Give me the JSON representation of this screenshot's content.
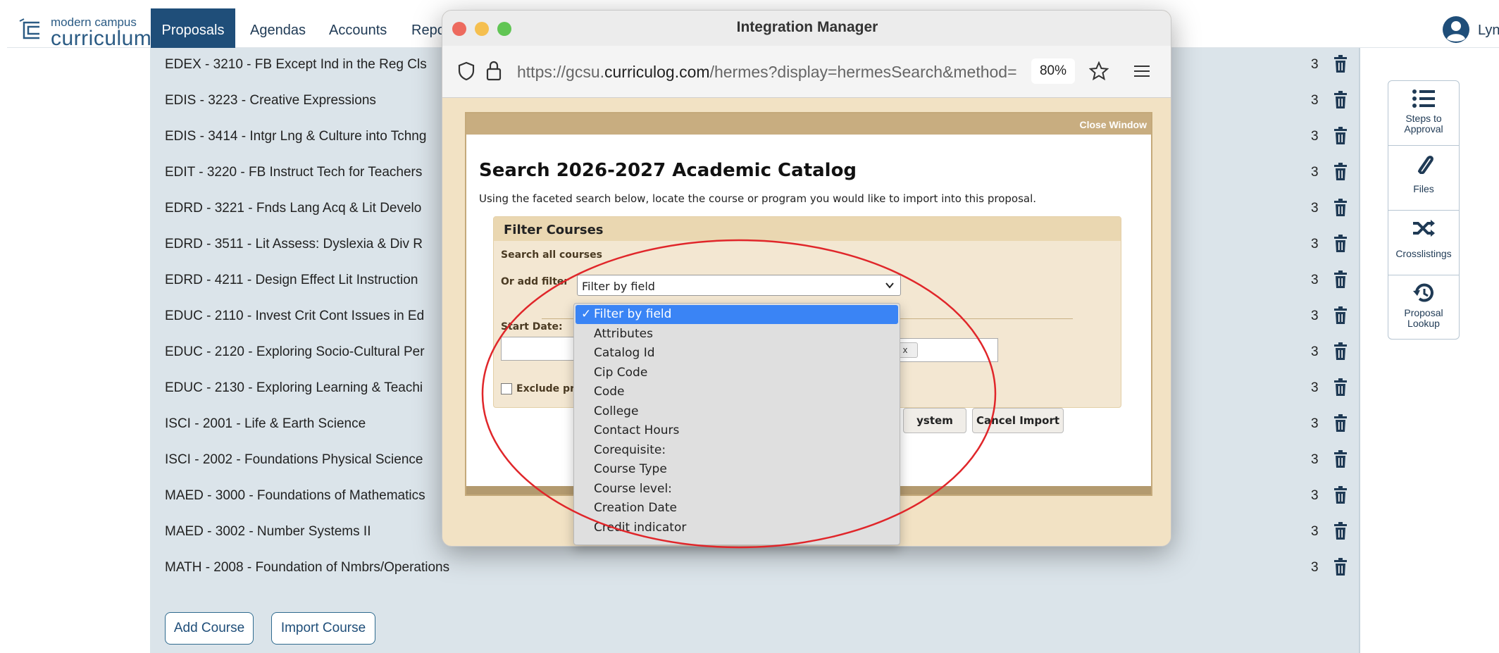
{
  "nav": {
    "logo_small": "modern campus",
    "logo_big": "curriculum",
    "logo_tm": "™",
    "active": "Proposals",
    "items": [
      "Agendas",
      "Accounts",
      "Repo"
    ],
    "user": "Lynd"
  },
  "courses": [
    {
      "name": "EDEX - 3210 - FB Except Ind in the Reg Cls",
      "credits": "3"
    },
    {
      "name": "EDIS - 3223 - Creative Expressions",
      "credits": "3"
    },
    {
      "name": "EDIS - 3414 - Intgr Lng & Culture into Tchng",
      "credits": "3"
    },
    {
      "name": "EDIT - 3220 - FB Instruct Tech for Teachers",
      "credits": "3"
    },
    {
      "name": "EDRD - 3221 - Fnds Lang Acq & Lit Develo",
      "credits": "3"
    },
    {
      "name": "EDRD - 3511 - Lit Assess: Dyslexia & Div R",
      "credits": "3"
    },
    {
      "name": "EDRD - 4211 - Design Effect Lit Instruction",
      "credits": "3"
    },
    {
      "name": "EDUC - 2110 - Invest Crit Cont Issues in Ed",
      "credits": "3"
    },
    {
      "name": "EDUC - 2120 - Exploring Socio-Cultural Per",
      "credits": "3"
    },
    {
      "name": "EDUC - 2130 - Exploring Learning & Teachi",
      "credits": "3"
    },
    {
      "name": "ISCI - 2001 - Life & Earth Science",
      "credits": "3"
    },
    {
      "name": "ISCI - 2002 - Foundations Physical Science",
      "credits": "3"
    },
    {
      "name": "MAED - 3000 - Foundations of Mathematics",
      "credits": "3"
    },
    {
      "name": "MAED - 3002 - Number Systems II",
      "credits": "3"
    },
    {
      "name": "MATH - 2008 - Foundation of Nmbrs/Operations",
      "credits": "3"
    }
  ],
  "buttons": {
    "add_course": "Add Course",
    "import_course": "Import Course"
  },
  "side": [
    {
      "icon": "list-icon",
      "label": "Steps to Approval"
    },
    {
      "icon": "paperclip-icon",
      "label": "Files"
    },
    {
      "icon": "shuffle-icon",
      "label": "Crosslistings"
    },
    {
      "icon": "history-icon",
      "label": "Proposal Lookup"
    }
  ],
  "popup": {
    "title": "Integration Manager",
    "url_prefix": "https://gcsu.",
    "url_domain": "curriculog.com",
    "url_rest": "/hermes?display=hermesSearch&method=",
    "zoom": "80%"
  },
  "dialog": {
    "close": "Close Window",
    "title": "Search 2026-2027 Academic Catalog",
    "desc": "Using the faceted search below, locate the course or program you would like to import into this proposal.",
    "filter_title": "Filter Courses",
    "search_all": "Search all courses",
    "or_add_filter": "Or add filter",
    "select_value": "Filter by field",
    "start_date": "Start Date:",
    "exclude": "Exclude pr",
    "x_chip": "x",
    "btn_system": "ystem",
    "btn_cancel": "Cancel Import"
  },
  "dropdown": {
    "options": [
      "Filter by field",
      "Attributes",
      "Catalog Id",
      "Cip Code",
      "Code",
      "College",
      "Contact Hours",
      "Corequisite:",
      "Course Type",
      "Course level:",
      "Creation Date",
      "Credit indicator"
    ],
    "selected": "Filter by field",
    "check": "✓"
  },
  "colors": {
    "nav_active": "#1f4e79",
    "highlight": "#3a84f5",
    "annotation": "#e0262a"
  }
}
